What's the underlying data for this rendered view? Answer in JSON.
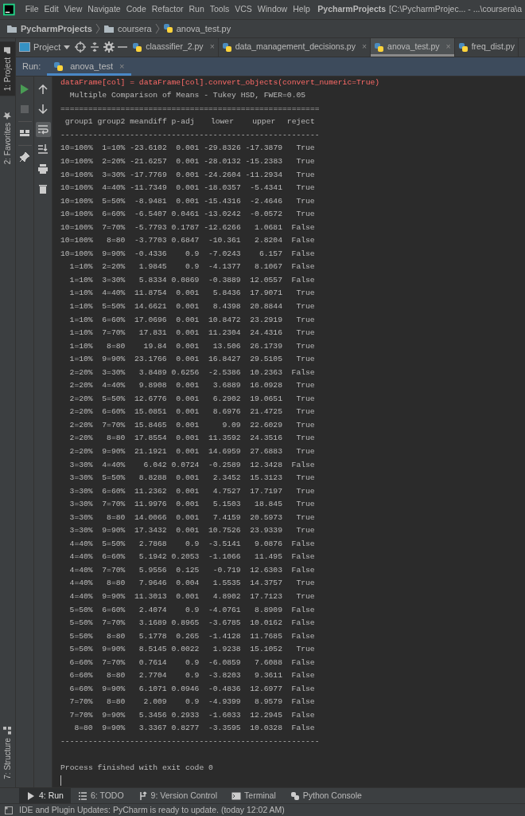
{
  "menu_bar": {
    "items": [
      "File",
      "Edit",
      "View",
      "Navigate",
      "Code",
      "Refactor",
      "Run",
      "Tools",
      "VCS",
      "Window",
      "Help"
    ],
    "project": "PycharmProjects",
    "path": "[C:\\PycharmProjec... - ...\\coursera\\a"
  },
  "breadcrumbs": [
    {
      "label": "PycharmProjects",
      "kind": "folder"
    },
    {
      "label": "coursera",
      "kind": "folder"
    },
    {
      "label": "anova_test.py",
      "kind": "file"
    }
  ],
  "left_stripe": {
    "top_tabs": [
      {
        "label": "1: Project",
        "selected": true
      },
      {
        "label": "2: Favorites",
        "selected": false
      }
    ],
    "bottom_tabs": [
      {
        "label": "7: Structure",
        "selected": false
      }
    ]
  },
  "project_dropdown": "Project",
  "editor_tabs": [
    {
      "label": "claassifier_2.py",
      "selected": false,
      "close": "×"
    },
    {
      "label": "data_management_decisions.py",
      "selected": false,
      "close": "×"
    },
    {
      "label": "anova_test.py",
      "selected": true,
      "close": "×"
    },
    {
      "label": "freq_dist.py",
      "selected": false
    }
  ],
  "run_panel": {
    "label": "Run:",
    "tabs": [
      {
        "label": "anova_test",
        "selected": true,
        "close": "×"
      }
    ]
  },
  "run_toolbar": {
    "left": [
      {
        "kind": "run",
        "disabled": false
      },
      {
        "kind": "stop",
        "disabled": true
      },
      {
        "kind": "layout",
        "disabled": false
      },
      {
        "kind": "pin",
        "disabled": false
      }
    ],
    "right": [
      {
        "kind": "up",
        "on": false
      },
      {
        "kind": "down",
        "on": false
      },
      {
        "kind": "wrap",
        "on": true
      },
      {
        "kind": "scroll_end",
        "on": false
      },
      {
        "kind": "print",
        "on": false
      },
      {
        "kind": "trash",
        "on": false
      }
    ]
  },
  "console": {
    "error_line": "dataFrame[col] = dataFrame[col].convert_objects(convert_numeric=True)",
    "title": "Multiple Comparison of Means - Tukey HSD, FWER=0.05",
    "rule_top": "========================================================",
    "columns": [
      "group1",
      "group2",
      "meandiff",
      "p-adj",
      "lower",
      "upper",
      "reject"
    ],
    "rule_mid": "--------------------------------------------------------",
    "rows": [
      [
        "10=100%",
        "1=10%",
        "-23.6102",
        "0.001",
        "-29.8326",
        "-17.3879",
        "True"
      ],
      [
        "10=100%",
        "2=20%",
        "-21.6257",
        "0.001",
        "-28.0132",
        "-15.2383",
        "True"
      ],
      [
        "10=100%",
        "3=30%",
        "-17.7769",
        "0.001",
        "-24.2604",
        "-11.2934",
        "True"
      ],
      [
        "10=100%",
        "4=40%",
        "-11.7349",
        "0.001",
        "-18.0357",
        "-5.4341",
        "True"
      ],
      [
        "10=100%",
        "5=50%",
        "-8.9481",
        "0.001",
        "-15.4316",
        "-2.4646",
        "True"
      ],
      [
        "10=100%",
        "6=60%",
        "-6.5407",
        "0.0461",
        "-13.0242",
        "-0.0572",
        "True"
      ],
      [
        "10=100%",
        "7=70%",
        "-5.7793",
        "0.1787",
        "-12.6266",
        "1.0681",
        "False"
      ],
      [
        "10=100%",
        "8=80",
        "-3.7703",
        "0.6847",
        "-10.361",
        "2.8204",
        "False"
      ],
      [
        "10=100%",
        "9=90%",
        "-0.4336",
        "0.9",
        "-7.0243",
        "6.157",
        "False"
      ],
      [
        "1=10%",
        "2=20%",
        "1.9845",
        "0.9",
        "-4.1377",
        "8.1067",
        "False"
      ],
      [
        "1=10%",
        "3=30%",
        "5.8334",
        "0.0869",
        "-0.3889",
        "12.0557",
        "False"
      ],
      [
        "1=10%",
        "4=40%",
        "11.8754",
        "0.001",
        "5.8436",
        "17.9071",
        "True"
      ],
      [
        "1=10%",
        "5=50%",
        "14.6621",
        "0.001",
        "8.4398",
        "20.8844",
        "True"
      ],
      [
        "1=10%",
        "6=60%",
        "17.0696",
        "0.001",
        "10.8472",
        "23.2919",
        "True"
      ],
      [
        "1=10%",
        "7=70%",
        "17.831",
        "0.001",
        "11.2304",
        "24.4316",
        "True"
      ],
      [
        "1=10%",
        "8=80",
        "19.84",
        "0.001",
        "13.506",
        "26.1739",
        "True"
      ],
      [
        "1=10%",
        "9=90%",
        "23.1766",
        "0.001",
        "16.8427",
        "29.5105",
        "True"
      ],
      [
        "2=20%",
        "3=30%",
        "3.8489",
        "0.6256",
        "-2.5386",
        "10.2363",
        "False"
      ],
      [
        "2=20%",
        "4=40%",
        "9.8908",
        "0.001",
        "3.6889",
        "16.0928",
        "True"
      ],
      [
        "2=20%",
        "5=50%",
        "12.6776",
        "0.001",
        "6.2902",
        "19.0651",
        "True"
      ],
      [
        "2=20%",
        "6=60%",
        "15.0851",
        "0.001",
        "8.6976",
        "21.4725",
        "True"
      ],
      [
        "2=20%",
        "7=70%",
        "15.8465",
        "0.001",
        "9.09",
        "22.6029",
        "True"
      ],
      [
        "2=20%",
        "8=80",
        "17.8554",
        "0.001",
        "11.3592",
        "24.3516",
        "True"
      ],
      [
        "2=20%",
        "9=90%",
        "21.1921",
        "0.001",
        "14.6959",
        "27.6883",
        "True"
      ],
      [
        "3=30%",
        "4=40%",
        "6.042",
        "0.0724",
        "-0.2589",
        "12.3428",
        "False"
      ],
      [
        "3=30%",
        "5=50%",
        "8.8288",
        "0.001",
        "2.3452",
        "15.3123",
        "True"
      ],
      [
        "3=30%",
        "6=60%",
        "11.2362",
        "0.001",
        "4.7527",
        "17.7197",
        "True"
      ],
      [
        "3=30%",
        "7=70%",
        "11.9976",
        "0.001",
        "5.1503",
        "18.845",
        "True"
      ],
      [
        "3=30%",
        "8=80",
        "14.0066",
        "0.001",
        "7.4159",
        "20.5973",
        "True"
      ],
      [
        "3=30%",
        "9=90%",
        "17.3432",
        "0.001",
        "10.7526",
        "23.9339",
        "True"
      ],
      [
        "4=40%",
        "5=50%",
        "2.7868",
        "0.9",
        "-3.5141",
        "9.0876",
        "False"
      ],
      [
        "4=40%",
        "6=60%",
        "5.1942",
        "0.2053",
        "-1.1066",
        "11.495",
        "False"
      ],
      [
        "4=40%",
        "7=70%",
        "5.9556",
        "0.125",
        "-0.719",
        "12.6303",
        "False"
      ],
      [
        "4=40%",
        "8=80",
        "7.9646",
        "0.004",
        "1.5535",
        "14.3757",
        "True"
      ],
      [
        "4=40%",
        "9=90%",
        "11.3013",
        "0.001",
        "4.8902",
        "17.7123",
        "True"
      ],
      [
        "5=50%",
        "6=60%",
        "2.4074",
        "0.9",
        "-4.0761",
        "8.8909",
        "False"
      ],
      [
        "5=50%",
        "7=70%",
        "3.1689",
        "0.8965",
        "-3.6785",
        "10.0162",
        "False"
      ],
      [
        "5=50%",
        "8=80",
        "5.1778",
        "0.265",
        "-1.4128",
        "11.7685",
        "False"
      ],
      [
        "5=50%",
        "9=90%",
        "8.5145",
        "0.0022",
        "1.9238",
        "15.1052",
        "True"
      ],
      [
        "6=60%",
        "7=70%",
        "0.7614",
        "0.9",
        "-6.0859",
        "7.6088",
        "False"
      ],
      [
        "6=60%",
        "8=80",
        "2.7704",
        "0.9",
        "-3.8203",
        "9.3611",
        "False"
      ],
      [
        "6=60%",
        "9=90%",
        "6.1071",
        "0.0946",
        "-0.4836",
        "12.6977",
        "False"
      ],
      [
        "7=70%",
        "8=80",
        "2.009",
        "0.9",
        "-4.9399",
        "8.9579",
        "False"
      ],
      [
        "7=70%",
        "9=90%",
        "5.3456",
        "0.2933",
        "-1.6033",
        "12.2945",
        "False"
      ],
      [
        "8=80",
        "9=90%",
        "3.3367",
        "0.8277",
        "-3.3595",
        "10.0328",
        "False"
      ]
    ],
    "rule_bottom": "--------------------------------------------------------",
    "exit_message": "Process finished with exit code 0"
  },
  "tool_tabs": [
    {
      "label": "4: Run",
      "kind": "run",
      "selected": true
    },
    {
      "label": "6: TODO",
      "kind": "todo",
      "selected": false
    },
    {
      "label": "9: Version Control",
      "kind": "vcs",
      "selected": false
    },
    {
      "label": "Terminal",
      "kind": "terminal",
      "selected": false
    },
    {
      "label": "Python Console",
      "kind": "python",
      "selected": false
    }
  ],
  "status_bar": "IDE and Plugin Updates: PyCharm is ready to update. (today 12:02 AM)"
}
